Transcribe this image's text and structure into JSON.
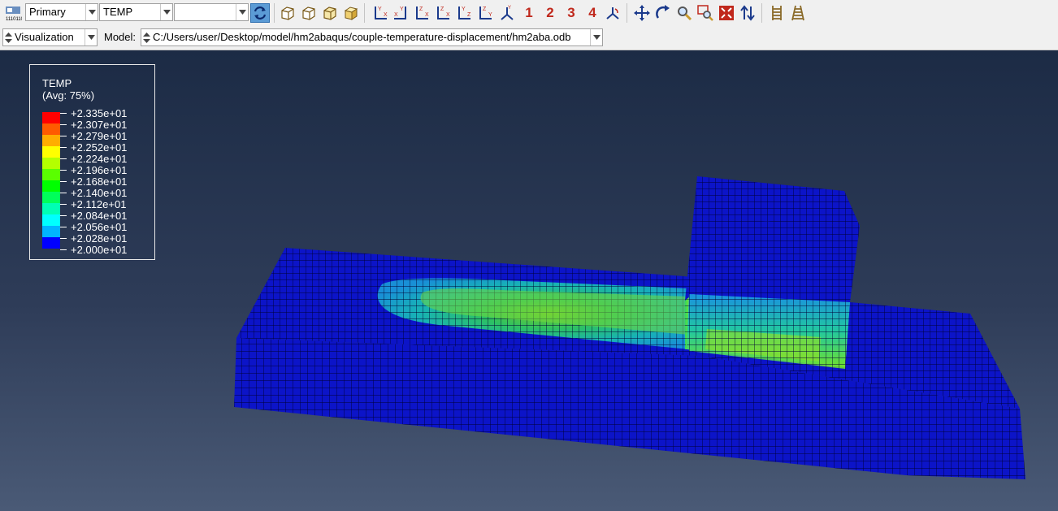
{
  "toolbar": {
    "render_style_combo": "Primary",
    "variable_combo": "TEMP",
    "third_combo": "",
    "view_buttons": [
      "iso-view",
      "front-view",
      "top-view",
      "box-view"
    ],
    "axis_view_buttons": [
      "xy-front",
      "xy-back",
      "zx-front",
      "zx-back",
      "yz-front",
      "yz-back",
      "iso-axes"
    ],
    "numbered_views": [
      "1",
      "2",
      "3",
      "4"
    ]
  },
  "context_bar": {
    "module_value": "Visualization",
    "model_label": "Model:",
    "model_path": "C:/Users/user/Desktop/model/hm2abaqus/couple-temperature-displacement/hm2aba.odb"
  },
  "legend": {
    "title_line1": "TEMP",
    "title_line2": "(Avg: 75%)",
    "entries": [
      {
        "label": "+2.335e+01",
        "color": "#ff0000"
      },
      {
        "label": "+2.307e+01",
        "color": "#ff5a00"
      },
      {
        "label": "+2.279e+01",
        "color": "#ffad00"
      },
      {
        "label": "+2.252e+01",
        "color": "#ffff00"
      },
      {
        "label": "+2.224e+01",
        "color": "#b4ff00"
      },
      {
        "label": "+2.196e+01",
        "color": "#5aff00"
      },
      {
        "label": "+2.168e+01",
        "color": "#00ff00"
      },
      {
        "label": "+2.140e+01",
        "color": "#00ff5a"
      },
      {
        "label": "+2.112e+01",
        "color": "#00ffb4"
      },
      {
        "label": "+2.084e+01",
        "color": "#00ffff"
      },
      {
        "label": "+2.056e+01",
        "color": "#00b4ff"
      },
      {
        "label": "+2.028e+01",
        "color": "#005aff"
      },
      {
        "label": "+2.000e+01",
        "color": "#0000ff"
      }
    ]
  },
  "colors": {
    "mesh_base": "#0c14c8",
    "mesh_lines": "#000033",
    "viewport_top": "#1c2b45",
    "viewport_bottom": "#4a5a76"
  }
}
